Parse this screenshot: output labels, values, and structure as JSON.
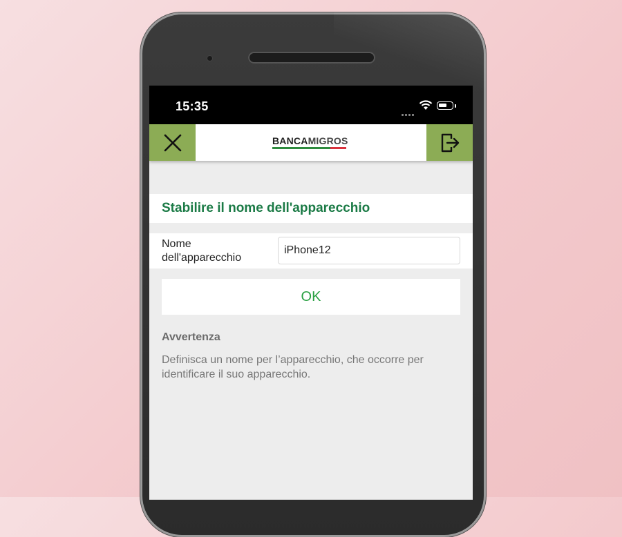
{
  "status_bar": {
    "time": "15:35"
  },
  "header": {
    "logo_left": "BANCA",
    "logo_right": "MIGROS",
    "brand_colors": {
      "green": "#8cac55",
      "logo_green": "#2e8b3e",
      "logo_red": "#d9323d"
    },
    "close_icon": "close-icon",
    "logout_icon": "logout-icon"
  },
  "page": {
    "title": "Stabilire il nome dell'apparecchio",
    "title_color": "#1a7a45"
  },
  "form": {
    "label": "Nome dell'apparecchio",
    "value": "iPhone12",
    "ok_label": "OK"
  },
  "notice": {
    "heading": "Avvertenza",
    "text": "Definisca un nome per l’apparecchio, che occorre per identificare il suo apparecchio."
  }
}
